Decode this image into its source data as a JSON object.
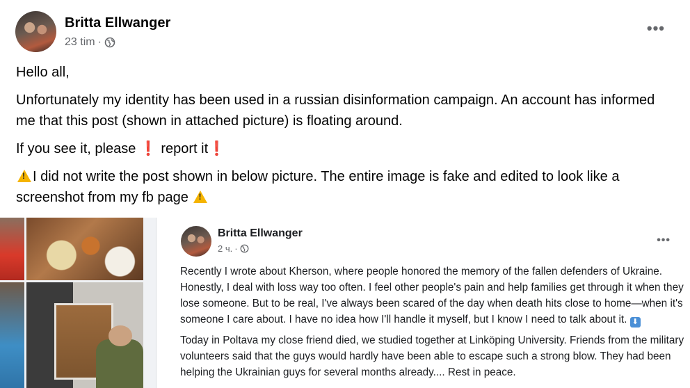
{
  "post": {
    "author": "Britta Ellwanger",
    "time": "23 tim",
    "separator": "·",
    "audience_icon": "globe-icon",
    "more_icon": "•••",
    "paragraphs": {
      "p1": "Hello all,",
      "p2": "Unfortunately my identity has been used in a russian disinformation campaign. An account has informed me that this post (shown in attached picture) is floating around.",
      "p3_a": "If you see it, please",
      "p3_b": "report it",
      "exclamation": "❗",
      "p4": "I did not write the post shown in below picture. The entire image is fake and edited to look like a screenshot from my fb page"
    }
  },
  "attached_image": {
    "author": "Britta Ellwanger",
    "time": "2 ч.",
    "separator": "·",
    "more_icon": "•••",
    "paragraph1": "Recently I wrote about Kherson, where people honored the memory of the fallen defenders of Ukraine. Honestly, I deal with loss way too often. I feel other people's pain and help families get through it when they lose someone. But to be real, I've always been scared of the day when death hits close to home—when it's someone I care about. I have no idea how I'll handle it myself, but I know I need to talk about it.",
    "down_emoji": "⬇",
    "paragraph2": "Today in Poltava my close friend died, we studied together at Linköping University. Friends from the military volunteers said that the guys would hardly have been able to escape such a strong blow. They had been helping the Ukrainian guys for several months already.... Rest in peace."
  },
  "colors": {
    "text_primary": "#050505",
    "text_secondary": "#65676b",
    "warning": "#f5b400",
    "exclamation": "#e02424",
    "background_secondary": "#f0f2f5"
  }
}
